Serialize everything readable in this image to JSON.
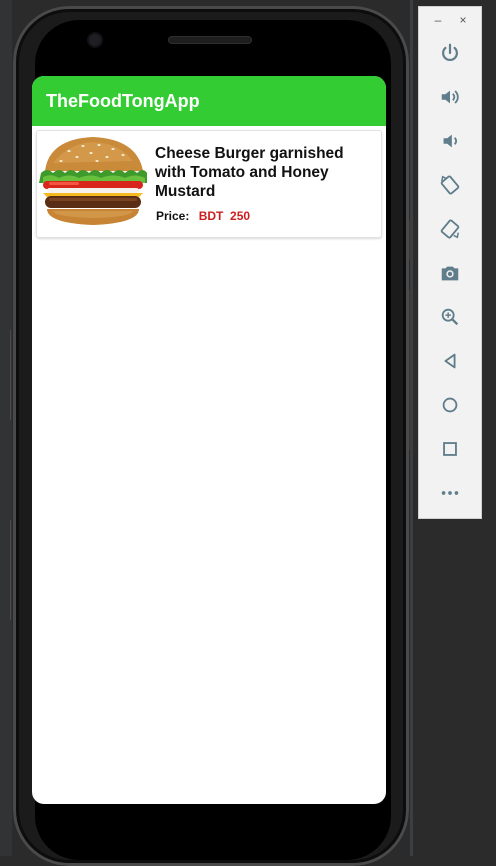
{
  "emulator": {
    "window_controls": {
      "minimize": "–",
      "close": "×"
    },
    "controls": [
      {
        "name": "power-icon"
      },
      {
        "name": "volume-up-icon"
      },
      {
        "name": "volume-down-icon"
      },
      {
        "name": "rotate-left-icon"
      },
      {
        "name": "rotate-right-icon"
      },
      {
        "name": "camera-icon"
      },
      {
        "name": "zoom-icon"
      },
      {
        "name": "back-icon"
      },
      {
        "name": "home-icon"
      },
      {
        "name": "overview-icon"
      },
      {
        "name": "more-icon"
      }
    ]
  },
  "app": {
    "title": "TheFoodTongApp",
    "colors": {
      "appbar": "#33cc33",
      "price": "#cc1e1e"
    },
    "items": [
      {
        "name": "Cheese Burger garnished with Tomato and Honey Mustard",
        "price_label": "Price:",
        "price_value": "BDT  250",
        "image": "cheeseburger-image"
      }
    ]
  }
}
